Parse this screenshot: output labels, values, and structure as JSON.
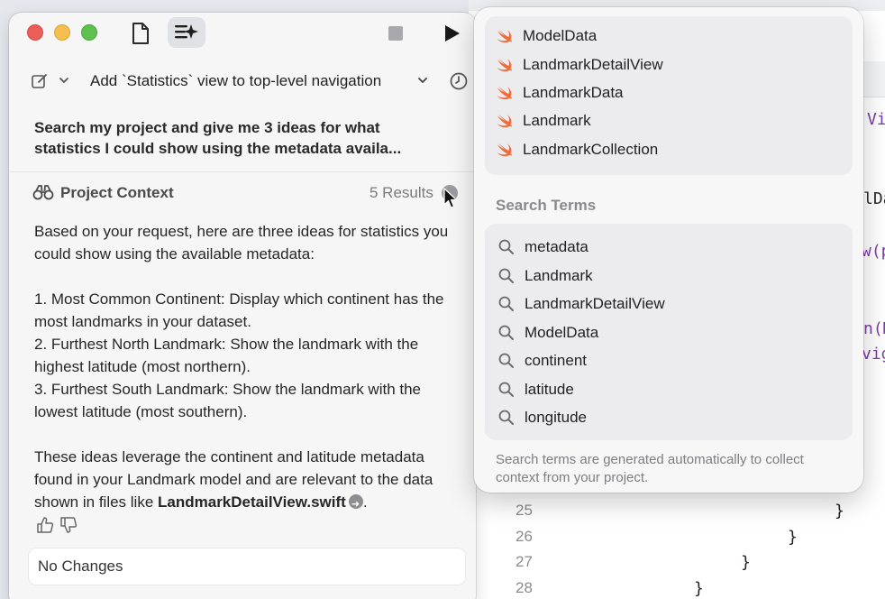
{
  "toolbar": {
    "title": "Add `Statistics` view to top-level navigation"
  },
  "conversation": {
    "user_message_line1": "Search my project and give me 3 ideas for what",
    "user_message_line2": "statistics I could show using the metadata availa...",
    "context_label": "Project Context",
    "context_results": "5 Results",
    "answer_intro": "Based on your request, here are three ideas for statistics you could show using the available metadata:",
    "idea_1": "1. Most Common Continent: Display which continent has the most landmarks in your dataset.",
    "idea_2": "2. Furthest North Landmark: Show the landmark with the highest latitude (most northern).",
    "idea_3": "3. Furthest South Landmark: Show the landmark with the lowest latitude (most southern).",
    "answer_outro": "These ideas leverage the continent and latitude metadata found in your Landmark model and are relevant to the data shown in files like",
    "file_link": "LandmarkDetailView.swift",
    "period": "."
  },
  "changes_bar": {
    "label": "No Changes"
  },
  "popover": {
    "files": [
      "ModelData",
      "LandmarkDetailView",
      "LandmarkData",
      "Landmark",
      "LandmarkCollection"
    ],
    "search_terms_heading": "Search Terms",
    "search_terms": [
      "metadata",
      "Landmark",
      "LandmarkDetailView",
      "ModelData",
      "continent",
      "latitude",
      "longitude"
    ],
    "footnote": "Search terms are generated automatically to collect context from your project."
  },
  "editor": {
    "line_numbers": [
      "25",
      "26",
      "27",
      "28"
    ],
    "fragments": [
      "Vi",
      "lDa",
      "w(p",
      "n(M",
      "vig"
    ]
  },
  "icons": {
    "doc": "document-icon",
    "spark": "sparkle-icon",
    "stop": "stop-icon",
    "play": "play-icon",
    "compose": "compose-icon",
    "history": "history-clock-icon",
    "context": "binoculars-icon",
    "info": "info-icon",
    "swift": "swift-file-icon",
    "search": "magnifier-icon",
    "thumbs_up": "thumbs-up-icon",
    "thumbs_down": "thumbs-down-icon"
  },
  "colors": {
    "traffic_red": "#ec5f59",
    "traffic_yellow": "#f4bf4f",
    "traffic_green": "#5ec04f",
    "swift_orange": "#f26b3a",
    "keyword_purple": "#7b3fa8"
  }
}
